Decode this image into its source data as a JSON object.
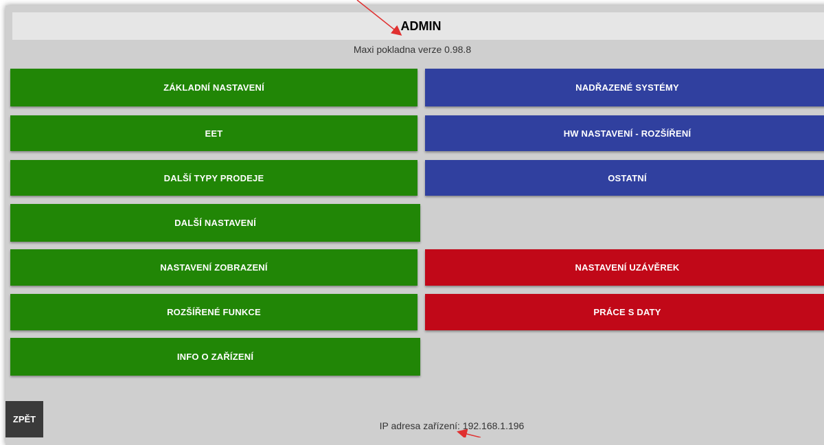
{
  "header": {
    "title": "ADMIN"
  },
  "version_text": "Maxi pokladna verze 0.98.8",
  "left_buttons": [
    "ZÁKLADNÍ NASTAVENÍ",
    "EET",
    "DALŠÍ TYPY PRODEJE",
    "DALŠÍ NASTAVENÍ",
    "NASTAVENÍ ZOBRAZENÍ",
    "ROZŠÍŘENÉ FUNKCE",
    "INFO O ZAŘÍZENÍ"
  ],
  "right_buttons": [
    "NADŘAZENÉ SYSTÉMY",
    "HW NASTAVENÍ - ROZŠÍŘENÍ",
    "OSTATNÍ",
    "NASTAVENÍ UZÁVĚREK",
    "PRÁCE S DATY"
  ],
  "back_label": "ZPĚT",
  "ip_text": "IP adresa zařízení: 192.168.1.196",
  "colors": {
    "green": "#218606",
    "blue": "#30409f",
    "red": "#c10818",
    "annotation_arrow": "#e03030"
  }
}
